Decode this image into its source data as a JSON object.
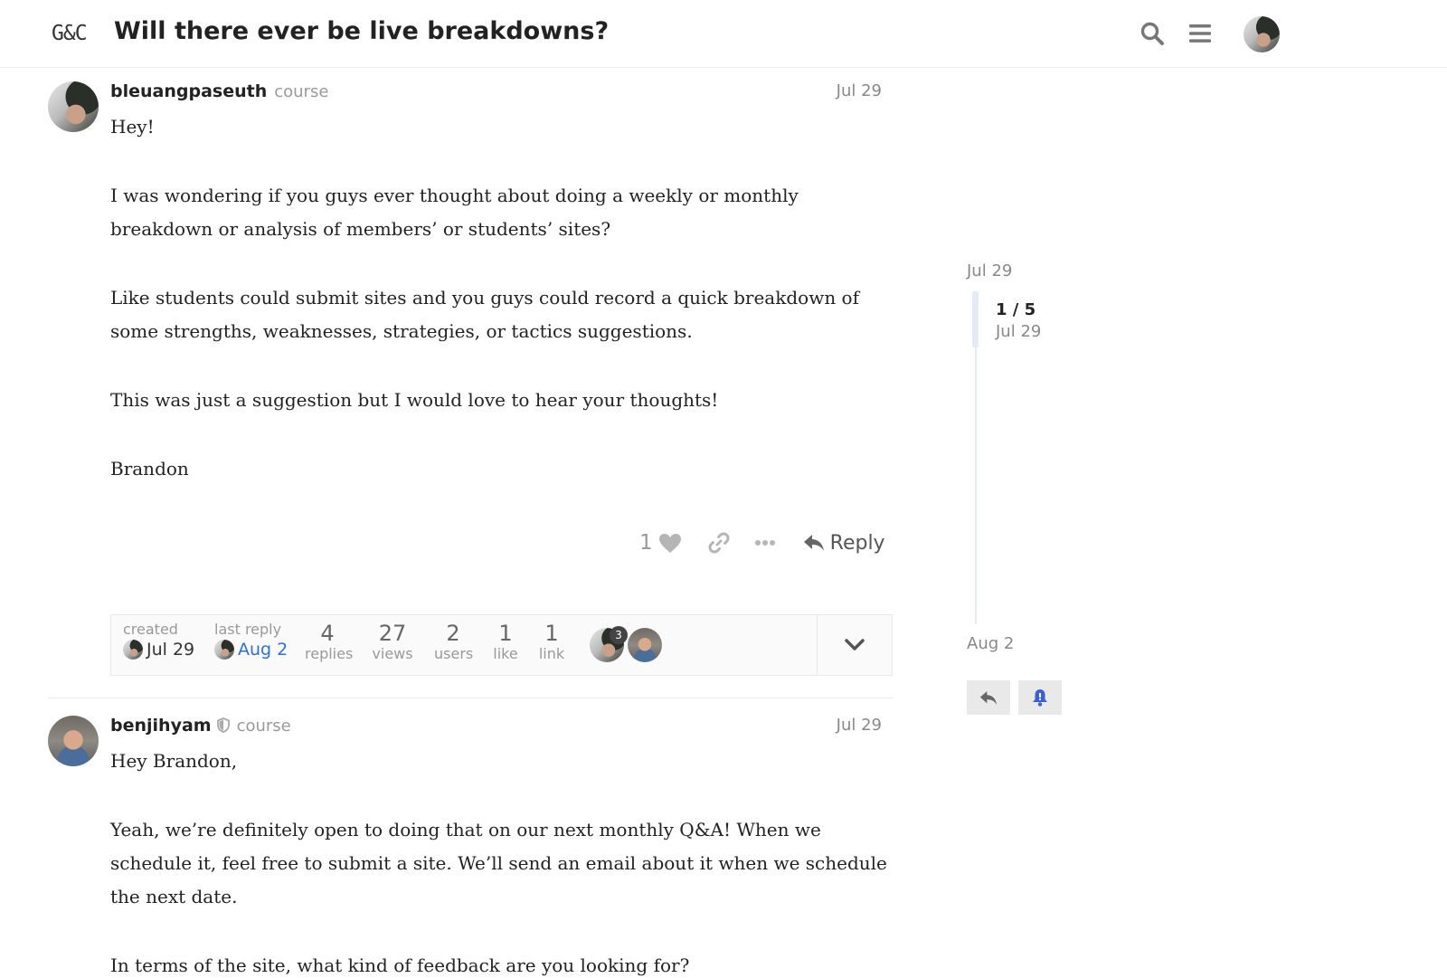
{
  "header": {
    "logo": "G&C",
    "title": "Will there ever be live breakdowns?",
    "icons": [
      "search-icon",
      "hamburger-menu-icon",
      "user-avatar"
    ]
  },
  "posts": [
    {
      "username": "bleuangpaseuth",
      "user_title": "course",
      "date": "Jul 29",
      "paragraphs": [
        "Hey!",
        "I was wondering if you guys ever thought about doing a weekly or monthly breakdown or analysis of members’ or students’ sites?",
        "Like students could submit sites and you guys could record a quick breakdown of some strengths, weaknesses, strategies, or tactics suggestions.",
        "This was just a suggestion but I would love to hear your thoughts!",
        "Brandon"
      ],
      "like_count": "1",
      "reply_label": "Reply"
    },
    {
      "username": "benjihyam",
      "user_title": "course",
      "date": "Jul 29",
      "paragraphs": [
        "Hey Brandon,",
        "Yeah, we’re definitely open to doing that on our next monthly Q&A! When we schedule it, feel free to submit a site. We’ll send an email about it when we schedule the next date.",
        "In terms of the site, what kind of feedback are you looking for?"
      ]
    }
  ],
  "topic_map": {
    "created_label": "created",
    "created_date": "Jul 29",
    "last_reply_label": "last reply",
    "last_reply_date": "Aug 2",
    "replies": "4",
    "replies_label": "replies",
    "views": "27",
    "views_label": "views",
    "users": "2",
    "users_label": "users",
    "likes": "1",
    "likes_label": "like",
    "links": "1",
    "links_label": "link",
    "participant_badge": "3"
  },
  "timeline": {
    "start_date": "Jul 29",
    "position": "1 / 5",
    "position_date": "Jul 29",
    "end_date": "Aug 2"
  },
  "colors": {
    "accent_link": "#2f6fd6",
    "notification_bell": "#3b5fd4",
    "muted_text": "#999999"
  }
}
